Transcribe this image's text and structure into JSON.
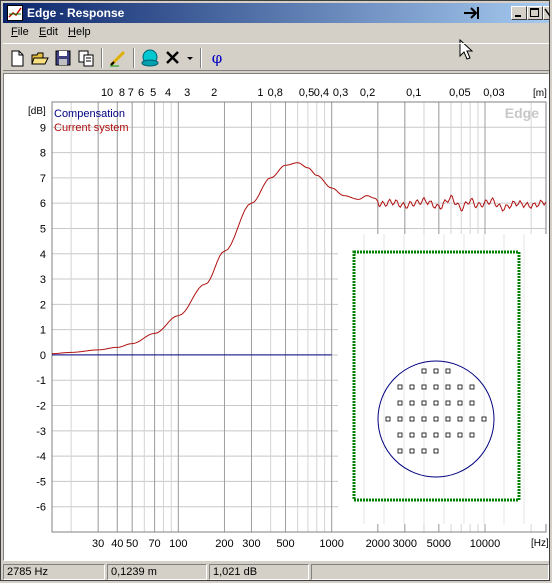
{
  "window": {
    "title": "Edge - Response"
  },
  "menu": [
    {
      "label": "File"
    },
    {
      "label": "Edit"
    },
    {
      "label": "Help"
    }
  ],
  "toolbar": {
    "phi_label": "φ"
  },
  "chart_data": {
    "type": "line",
    "watermark": "Edge",
    "ylabel": "[dB]",
    "xlabel_unit": "[Hz]",
    "top_axis_unit": "[m]",
    "ylim": [
      -7,
      10
    ],
    "xlim": [
      15,
      25000
    ],
    "y_ticks": [
      "9",
      "8",
      "7",
      "6",
      "5",
      "4",
      "3",
      "2",
      "1",
      "0",
      "-1",
      "-2",
      "-3",
      "-4",
      "-5",
      "-6"
    ],
    "x_ticks": [
      "30",
      "40",
      "50",
      "70",
      "100",
      "200",
      "300",
      "500",
      "1000",
      "2000",
      "3000",
      "5000",
      "10000"
    ],
    "top_ticks": [
      "10",
      "8",
      "7",
      "6",
      "5",
      "4",
      "3",
      "2",
      "1",
      "0,8",
      "0,5",
      "0,4",
      "0,3",
      "0,2",
      "0,1",
      "0,05",
      "0,03"
    ],
    "x_scale": "log",
    "grid": true,
    "legend_position": "top-left",
    "series": [
      {
        "name": "Compensation",
        "color": "#000080",
        "x": [
          15,
          1000
        ],
        "values": [
          0,
          0
        ]
      },
      {
        "name": "Current system",
        "color": "#b01010",
        "x": [
          15,
          20,
          30,
          40,
          50,
          70,
          100,
          150,
          200,
          300,
          400,
          500,
          600,
          700,
          800,
          1000,
          1200,
          1500,
          1700,
          1900,
          2100,
          2500,
          3000,
          3500,
          4000,
          5000,
          6000,
          7000,
          8000,
          9000,
          10000,
          11000,
          13000,
          16000,
          20000,
          25000
        ],
        "values": [
          0.05,
          0.1,
          0.2,
          0.3,
          0.45,
          0.85,
          1.55,
          2.8,
          4.1,
          6.0,
          7.0,
          7.5,
          7.6,
          7.4,
          7.1,
          6.6,
          6.3,
          6.15,
          6.3,
          6.2,
          5.95,
          6.05,
          5.9,
          6.0,
          6.1,
          5.85,
          6.2,
          5.8,
          6.1,
          5.9,
          6.0,
          6.1,
          5.8,
          6.0,
          5.9,
          6.05
        ]
      }
    ]
  },
  "inset": {
    "description_points": 37,
    "baffle_color": "#008000",
    "driver_color": "#000080"
  },
  "status": [
    {
      "text": "2785 Hz"
    },
    {
      "text": "0,1239 m"
    },
    {
      "text": "1,021 dB"
    },
    {
      "text": ""
    }
  ]
}
